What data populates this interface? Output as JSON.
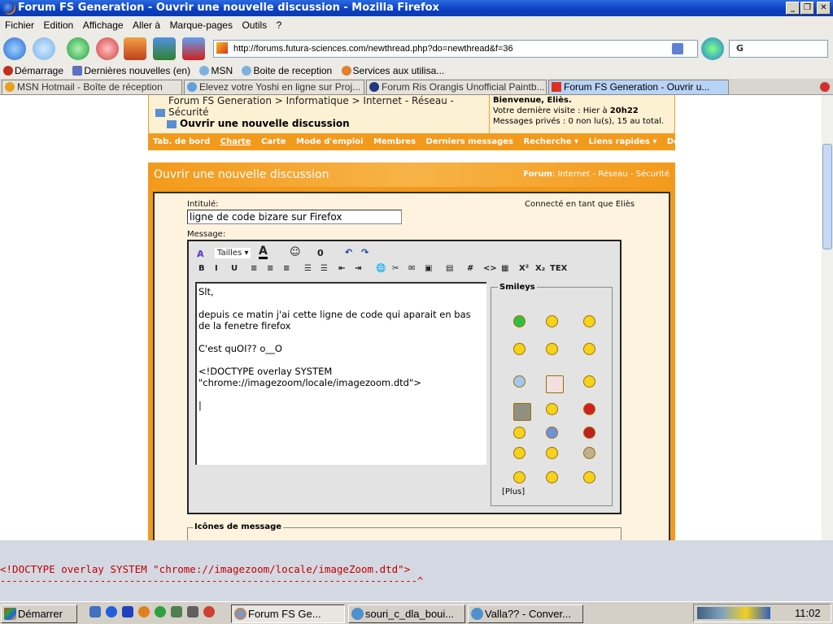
{
  "window": {
    "title": "Forum FS Generation - Ouvrir une nouvelle discussion - Mozilla Firefox",
    "controls": [
      "_",
      "❐",
      "✕"
    ]
  },
  "menu": [
    "Fichier",
    "Edition",
    "Affichage",
    "Aller à",
    "Marque-pages",
    "Outils",
    "?"
  ],
  "address": {
    "url": "http://forums.futura-sciences.com/newthread.php?do=newthread&f=36",
    "search_value": "G"
  },
  "bookmarks": [
    "Démarrage",
    "Dernières nouvelles (en)",
    "MSN",
    "Boite de reception",
    "Services aux utilisa..."
  ],
  "tabs": [
    {
      "label": "MSN Hotmail - Boîte de réception",
      "color": "#e8a020"
    },
    {
      "label": "Elevez votre Yoshi en ligne sur Proj...",
      "color": "#60a0e0"
    },
    {
      "label": "Forum Ris Orangis Unofficial Paintb...",
      "color": "#203880"
    },
    {
      "label": "Forum FS Generation - Ouvrir u...",
      "color": "#e03020"
    }
  ],
  "forum": {
    "breadcrumb": "Forum FS Generation > Informatique > Internet - Réseau - Sécurité",
    "current": "Ouvrir une nouvelle discussion",
    "welcome": {
      "line1": "Bienvenue, Eliès.",
      "line2_prefix": "Votre dernière visite : Hier à ",
      "line2_time": "20h22",
      "line3": "Messages privés : 0 non lu(s), 15 au total."
    },
    "nav": [
      "Tab. de bord",
      "Charte",
      "Carte",
      "Mode d'emploi",
      "Membres",
      "Derniers messages",
      "Recherche ▾",
      "Liens rapides ▾",
      "Déconnexion"
    ],
    "section_title": "Ouvrir une nouvelle discussion",
    "section_forum_label": "Forum",
    "section_forum_path": ": Internet - Réseau - Sécurité",
    "title_label": "Intitulé:",
    "title_value": "ligne de code bizare sur Firefox",
    "connected": "Connecté en tant que Eliès",
    "message_label": "Message:",
    "toolbar": {
      "size": "Tailles",
      "row1": [
        "A̷",
        "A",
        "☺",
        "0",
        "↶",
        "↷"
      ],
      "row2": [
        "B",
        "I",
        "U",
        "≡",
        "≡",
        "≡",
        "☰",
        "☰",
        "⇤",
        "⇥",
        "🌐",
        "✂",
        "✉",
        "▣",
        "▤",
        "#",
        "<>",
        "▦",
        "X²",
        "X₂",
        "TEX"
      ]
    },
    "message_text": "Slt,\n\ndepuis ce matin j'ai cette ligne de code qui aparait en bas de la fenetre firefox\n\nC'est quOI?? o__O\n\n<!DOCTYPE overlay SYSTEM \"chrome://imagezoom/locale/imagezoom.dtd\">\n\n|",
    "smileys_label": "Smileys",
    "smileys": [
      "green-grin",
      "rabbit",
      "dizzy",
      "confused",
      "gun",
      "blush",
      "question",
      "bide",
      "tongue",
      "good-night",
      "laugh",
      "cool-red",
      "smile",
      "blue-sleepy",
      "devil",
      "soldier",
      "scared",
      "bald",
      "hands-up",
      "oops",
      "grin-wave"
    ],
    "smileys_more": "[Plus]",
    "icons_label": "Icônes de message"
  },
  "console": {
    "error": "<!DOCTYPE overlay SYSTEM \"chrome://imagezoom/locale/imageZoom.dtd\">",
    "pointer": "-----------------------------------------------------------------------^"
  },
  "taskbar": {
    "start": "Démarrer",
    "tasks": [
      "Forum FS Ge...",
      "souri_c_dla_boui...",
      "Valla?? - Conver..."
    ],
    "clock": "11:02"
  }
}
